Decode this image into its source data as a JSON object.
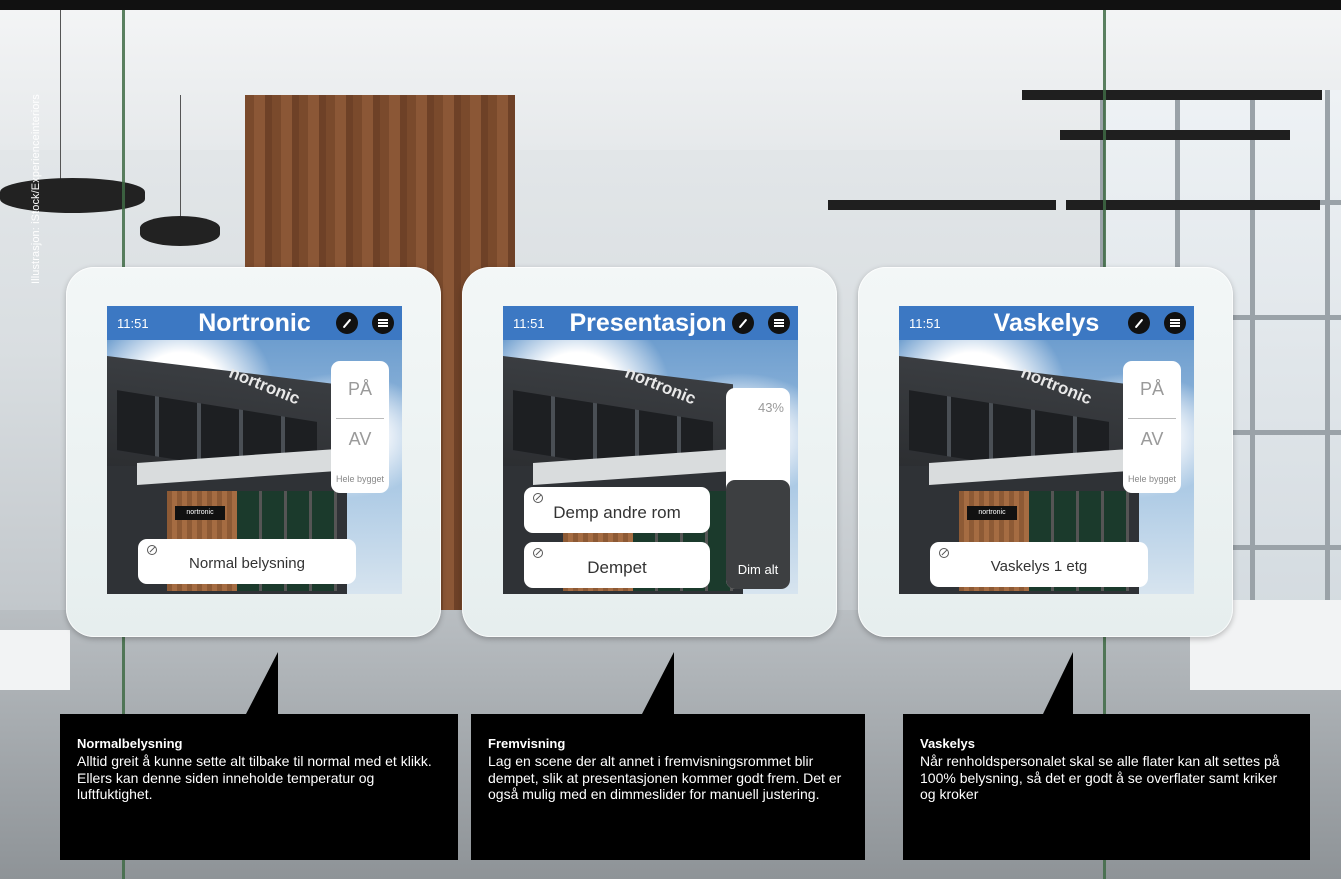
{
  "credit": "Illustrasjon: iStock/Experienceinteriors",
  "colors": {
    "titlebar": "#3c78c3",
    "callout_bg": "#000000",
    "dim_fill": "#3d3f41"
  },
  "panels": [
    {
      "time": "11:51",
      "title": "Nortronic",
      "edit_icon": "pencil-icon",
      "menu_icon": "menu-icon",
      "onoff": {
        "on": "PÅ",
        "off": "AV",
        "zone": "Hele bygget"
      },
      "scenes": [
        {
          "label": "Normal belysning"
        }
      ]
    },
    {
      "time": "11:51",
      "title": "Presentasjon",
      "edit_icon": "pencil-icon",
      "menu_icon": "menu-icon",
      "scenes": [
        {
          "label": "Demp andre rom"
        },
        {
          "label": "Dempet"
        }
      ],
      "dimmer": {
        "percent_label": "43%",
        "level": 0.43,
        "label": "Dim alt"
      }
    },
    {
      "time": "11:51",
      "title": "Vaskelys",
      "edit_icon": "pencil-icon",
      "menu_icon": "menu-icon",
      "onoff": {
        "on": "PÅ",
        "off": "AV",
        "zone": "Hele bygget"
      },
      "scenes": [
        {
          "label": "Vaskelys 1 etg"
        }
      ]
    }
  ],
  "callouts": [
    {
      "title": "Normalbelysning",
      "body": "Alltid greit å kunne sette alt tilbake til normal med et klikk. Ellers kan denne siden inneholde temperatur og luftfuktighet."
    },
    {
      "title": "Fremvisning",
      "body": "Lag en scene der alt annet i fremvisningsrommet blir dempet, slik at presentasjonen kommer godt frem. Det er også mulig med en dimmeslider for manuell justering."
    },
    {
      "title": "Vaskelys",
      "body": "Når renholdspersonalet skal se alle flater kan alt settes på 100% belysning, så det er godt å se overflater samt kriker og kroker"
    }
  ]
}
